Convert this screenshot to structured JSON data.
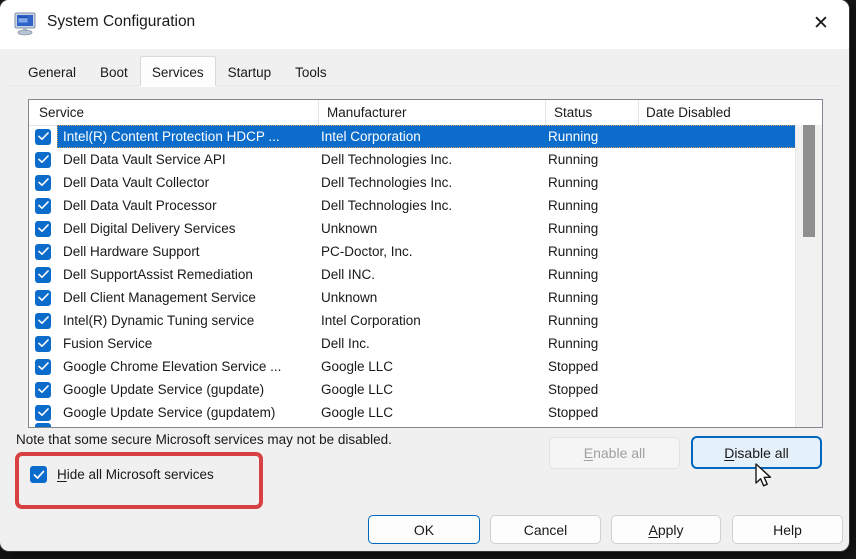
{
  "window": {
    "title": "System Configuration",
    "close_glyph": "✕"
  },
  "tabs": [
    {
      "label": "General",
      "active": false
    },
    {
      "label": "Boot",
      "active": false
    },
    {
      "label": "Services",
      "active": true
    },
    {
      "label": "Startup",
      "active": false
    },
    {
      "label": "Tools",
      "active": false
    }
  ],
  "services_table": {
    "columns": [
      "Service",
      "Manufacturer",
      "Status",
      "Date Disabled"
    ],
    "rows": [
      {
        "service": "Intel(R) Content Protection HDCP ...",
        "manufacturer": "Intel Corporation",
        "status": "Running",
        "date_disabled": "",
        "checked": true,
        "selected": true
      },
      {
        "service": "Dell Data Vault Service API",
        "manufacturer": "Dell Technologies Inc.",
        "status": "Running",
        "date_disabled": "",
        "checked": true,
        "selected": false
      },
      {
        "service": "Dell Data Vault Collector",
        "manufacturer": "Dell Technologies Inc.",
        "status": "Running",
        "date_disabled": "",
        "checked": true,
        "selected": false
      },
      {
        "service": "Dell Data Vault Processor",
        "manufacturer": "Dell Technologies Inc.",
        "status": "Running",
        "date_disabled": "",
        "checked": true,
        "selected": false
      },
      {
        "service": "Dell Digital Delivery Services",
        "manufacturer": "Unknown",
        "status": "Running",
        "date_disabled": "",
        "checked": true,
        "selected": false
      },
      {
        "service": "Dell Hardware Support",
        "manufacturer": "PC-Doctor, Inc.",
        "status": "Running",
        "date_disabled": "",
        "checked": true,
        "selected": false
      },
      {
        "service": "Dell SupportAssist Remediation",
        "manufacturer": "Dell INC.",
        "status": "Running",
        "date_disabled": "",
        "checked": true,
        "selected": false
      },
      {
        "service": "Dell Client Management Service",
        "manufacturer": "Unknown",
        "status": "Running",
        "date_disabled": "",
        "checked": true,
        "selected": false
      },
      {
        "service": "Intel(R) Dynamic Tuning service",
        "manufacturer": "Intel Corporation",
        "status": "Running",
        "date_disabled": "",
        "checked": true,
        "selected": false
      },
      {
        "service": "Fusion Service",
        "manufacturer": "Dell Inc.",
        "status": "Running",
        "date_disabled": "",
        "checked": true,
        "selected": false
      },
      {
        "service": "Google Chrome Elevation Service ...",
        "manufacturer": "Google LLC",
        "status": "Stopped",
        "date_disabled": "",
        "checked": true,
        "selected": false
      },
      {
        "service": "Google Update Service (gupdate)",
        "manufacturer": "Google LLC",
        "status": "Stopped",
        "date_disabled": "",
        "checked": true,
        "selected": false
      },
      {
        "service": "Google Update Service (gupdatem)",
        "manufacturer": "Google LLC",
        "status": "Stopped",
        "date_disabled": "",
        "checked": true,
        "selected": false
      }
    ]
  },
  "note": "Note that some secure Microsoft services may not be disabled.",
  "hide_checkbox": {
    "label": "Hide all Microsoft services",
    "checked": true
  },
  "buttons": {
    "enable_all": "Enable all",
    "disable_all": "Disable all",
    "ok": "OK",
    "cancel": "Cancel",
    "apply": "Apply",
    "help": "Help"
  },
  "colors": {
    "selection-blue": "#0b6ccb",
    "checkbox-blue": "#0b6ccb",
    "accent-blue": "#0067c0",
    "annotation-red": "#d84043"
  }
}
